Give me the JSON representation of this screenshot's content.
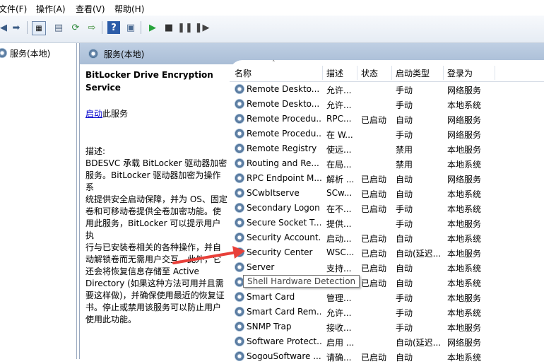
{
  "menu": [
    "文件(F)",
    "操作(A)",
    "查看(V)",
    "帮助(H)"
  ],
  "toolbar": {
    "icons": [
      "back-icon",
      "forward-icon",
      "show-tree-icon",
      "properties-icon",
      "refresh-icon",
      "export-icon",
      "help-icon",
      "console-icon",
      "start-service-icon",
      "stop-service-icon",
      "pause-service-icon",
      "restart-service-icon"
    ]
  },
  "tree": {
    "root_label": "服务(本地)"
  },
  "panel": {
    "title": "服务(本地)"
  },
  "description": {
    "service_title_line1": "BitLocker Drive Encryption",
    "service_title_line2": "Service",
    "start_link": "启动",
    "start_suffix": "此服务",
    "label": "描述:",
    "body_lines": [
      "BDESVC 承载 BitLocker 驱动器加密",
      "服务。BitLocker 驱动器加密为操作系",
      "统提供安全启动保障，并为 OS、固定",
      "卷和可移动卷提供全卷加密功能。使",
      "用此服务，BitLocker 可以提示用户执",
      "行与已安装卷相关的各种操作，并自",
      "动解锁卷而无需用户交互。此外，它",
      "还会将恢复信息存储至 Active",
      "Directory (如果这种方法可用并且需",
      "要这样做)，并确保使用最近的恢复证",
      "书。停止或禁用该服务可以防止用户",
      "使用此功能。"
    ]
  },
  "columns": {
    "name": "名称",
    "desc": "描述",
    "status": "状态",
    "startup": "启动类型",
    "logon": "登录为"
  },
  "services": [
    {
      "name": "Remote Deskto...",
      "desc": "允许...",
      "status": "",
      "startup": "手动",
      "logon": "网络服务"
    },
    {
      "name": "Remote Deskto...",
      "desc": "允许...",
      "status": "",
      "startup": "手动",
      "logon": "本地系统"
    },
    {
      "name": "Remote Procedu...",
      "desc": "RPC...",
      "status": "已启动",
      "startup": "自动",
      "logon": "网络服务"
    },
    {
      "name": "Remote Procedu...",
      "desc": "在 W...",
      "status": "",
      "startup": "手动",
      "logon": "网络服务"
    },
    {
      "name": "Remote Registry",
      "desc": "使远...",
      "status": "",
      "startup": "禁用",
      "logon": "本地服务"
    },
    {
      "name": "Routing and Re...",
      "desc": "在局...",
      "status": "",
      "startup": "禁用",
      "logon": "本地系统"
    },
    {
      "name": "RPC Endpoint M...",
      "desc": "解析 ...",
      "status": "已启动",
      "startup": "自动",
      "logon": "网络服务"
    },
    {
      "name": "SCwbItserve",
      "desc": "SCw...",
      "status": "已启动",
      "startup": "自动",
      "logon": "本地系统"
    },
    {
      "name": "Secondary Logon",
      "desc": "在不...",
      "status": "已启动",
      "startup": "手动",
      "logon": "本地系统"
    },
    {
      "name": "Secure Socket T...",
      "desc": "提供...",
      "status": "",
      "startup": "手动",
      "logon": "本地服务"
    },
    {
      "name": "Security Account...",
      "desc": "启动...",
      "status": "已启动",
      "startup": "自动",
      "logon": "本地系统"
    },
    {
      "name": "Security Center",
      "desc": "WSC...",
      "status": "已启动",
      "startup": "自动(延迟...",
      "logon": "本地服务"
    },
    {
      "name": "Server",
      "desc": "支持...",
      "status": "已启动",
      "startup": "自动",
      "logon": "本地系统"
    },
    {
      "name": "",
      "desc": "",
      "status": "已启动",
      "startup": "自动",
      "logon": "本地系统"
    },
    {
      "name": "Smart Card",
      "desc": "管理...",
      "status": "",
      "startup": "手动",
      "logon": "本地服务"
    },
    {
      "name": "Smart Card Rem...",
      "desc": "允许...",
      "status": "",
      "startup": "手动",
      "logon": "本地系统"
    },
    {
      "name": "SNMP Trap",
      "desc": "接收...",
      "status": "",
      "startup": "手动",
      "logon": "本地服务"
    },
    {
      "name": "Software Protect...",
      "desc": "启用 ...",
      "status": "",
      "startup": "自动(延迟...",
      "logon": "网络服务"
    },
    {
      "name": "SogouSoftware ...",
      "desc": "请确...",
      "status": "已启动",
      "startup": "自动",
      "logon": "本地系统"
    }
  ],
  "tooltip": "Shell Hardware Detection",
  "colors": {
    "annotation_arrow": "#e8403a",
    "link": "#0000cc",
    "header_bar": "#b3c5dc"
  }
}
